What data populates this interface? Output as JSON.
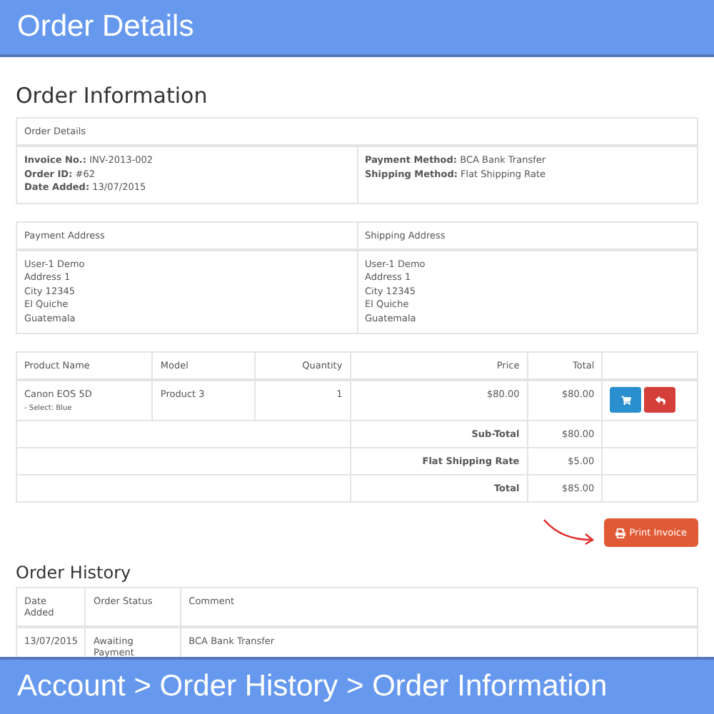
{
  "header": {
    "title": "Order Details"
  },
  "page_title": "Order Information",
  "order_details": {
    "heading": "Order Details",
    "left": [
      {
        "label": "Invoice No.:",
        "value": "INV-2013-002"
      },
      {
        "label": "Order ID:",
        "value": "#62"
      },
      {
        "label": "Date Added:",
        "value": "13/07/2015"
      }
    ],
    "right": [
      {
        "label": "Payment Method:",
        "value": "BCA Bank Transfer"
      },
      {
        "label": "Shipping Method:",
        "value": "Flat Shipping Rate"
      }
    ]
  },
  "addresses": [
    {
      "heading": "Payment Address",
      "lines": [
        "User-1 Demo",
        "Address 1",
        "City 12345",
        "El Quiche",
        "Guatemala"
      ]
    },
    {
      "heading": "Shipping Address",
      "lines": [
        "User-1 Demo",
        "Address 1",
        "City 12345",
        "El Quiche",
        "Guatemala"
      ]
    }
  ],
  "products": {
    "columns": [
      "Product Name",
      "Model",
      "Quantity",
      "Price",
      "Total"
    ],
    "rows": [
      {
        "name": "Canon EOS 5D",
        "option": "- Select: Blue",
        "model": "Product 3",
        "quantity": "1",
        "price": "$80.00",
        "total": "$80.00"
      }
    ],
    "totals": [
      {
        "label": "Sub-Total",
        "value": "$80.00"
      },
      {
        "label": "Flat Shipping Rate",
        "value": "$5.00"
      },
      {
        "label": "Total",
        "value": "$85.00"
      }
    ]
  },
  "print_button": "Print Invoice",
  "history": {
    "title": "Order History",
    "columns": [
      "Date Added",
      "Order Status",
      "Comment"
    ],
    "rows": [
      {
        "date": "13/07/2015",
        "status": "Awaiting Payment",
        "comment": "BCA Bank Transfer"
      }
    ]
  },
  "footer": {
    "breadcrumb": "Account > Order History > Order Information"
  }
}
